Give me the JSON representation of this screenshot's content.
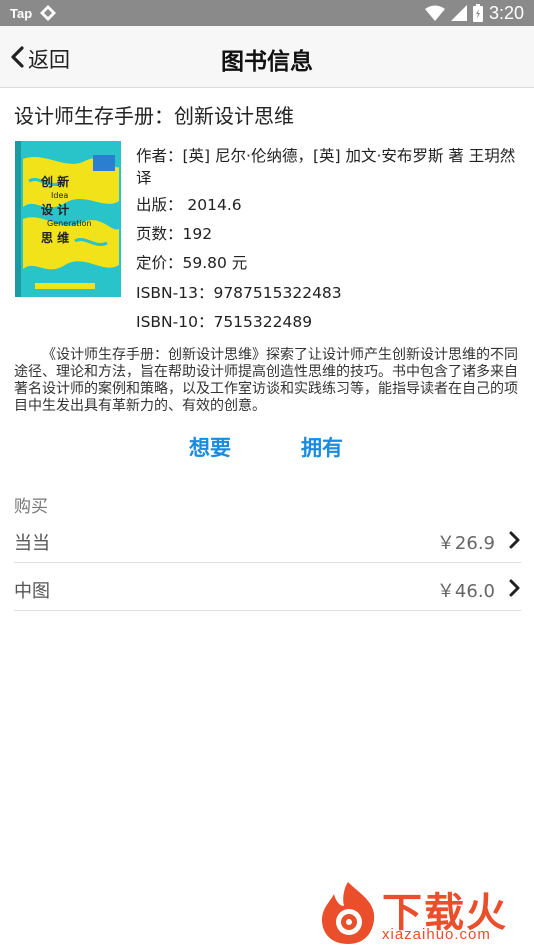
{
  "status_bar": {
    "carrier": "Tap",
    "time": "3:20"
  },
  "nav": {
    "back_label": "返回",
    "title": "图书信息"
  },
  "book": {
    "title": "设计师生存手册：创新设计思维",
    "cover_text": {
      "line1": "创  新",
      "line2": "Idea",
      "line3": "设  计",
      "line4": "Generation",
      "line5": "思  维"
    },
    "info": {
      "author": "作者：[英] 尼尔·伦纳德，[英] 加文·安布罗斯 著 王玥然 译",
      "publish": "出版： 2014.6",
      "pages": "页数：192",
      "price": "定价：59.80 元",
      "isbn13": "ISBN-13：9787515322483",
      "isbn10": "ISBN-10：7515322489"
    },
    "description": "《设计师生存手册：创新设计思维》探索了让设计师产生创新设计思维的不同途径、理论和方法，旨在帮助设计师提高创造性思维的技巧。书中包含了诸多来自著名设计师的案例和策略，以及工作室访谈和实践练习等，能指导读者在自己的项目中生发出具有革新力的、有效的创意。"
  },
  "actions": {
    "want": "想要",
    "own": "拥有"
  },
  "buy": {
    "header": "购买",
    "shops": [
      {
        "name": "当当",
        "price": "￥26.9"
      },
      {
        "name": "中图",
        "price": "￥46.0"
      }
    ]
  },
  "watermark": {
    "text": "下载火",
    "url": "xiazaihuo.com"
  },
  "colors": {
    "accent": "#1a8ce0",
    "cover_bg": "#29c4c9",
    "cover_pattern": "#f2e21a",
    "watermark": "#ea4e2a"
  }
}
